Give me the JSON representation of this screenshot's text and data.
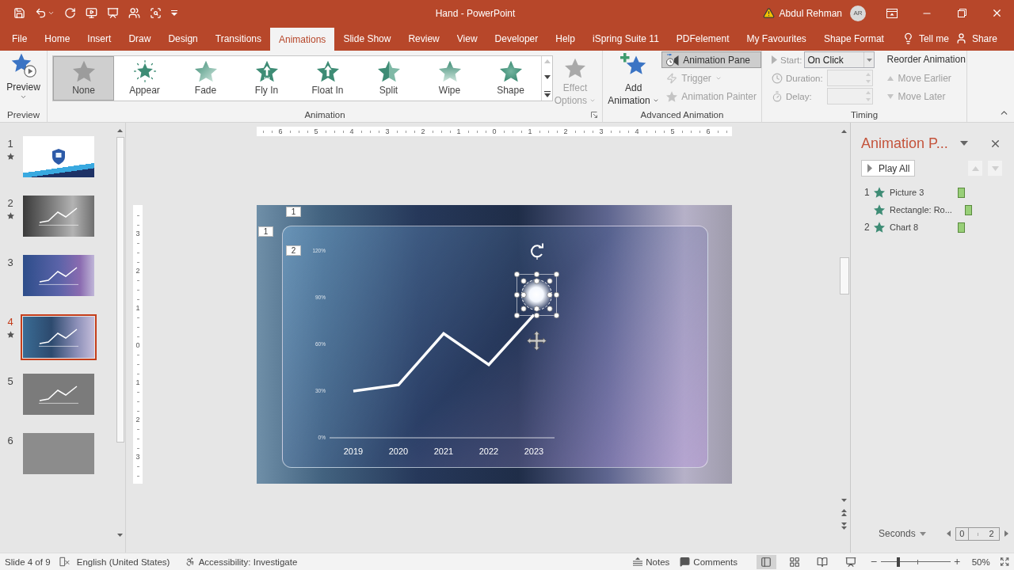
{
  "title_bar": {
    "title": "Hand - PowerPoint",
    "user_name": "Abdul Rehman",
    "user_initials": "AR"
  },
  "tabs": [
    {
      "label": "File",
      "selected": false
    },
    {
      "label": "Home",
      "selected": false
    },
    {
      "label": "Insert",
      "selected": false
    },
    {
      "label": "Draw",
      "selected": false
    },
    {
      "label": "Design",
      "selected": false
    },
    {
      "label": "Transitions",
      "selected": false
    },
    {
      "label": "Animations",
      "selected": true
    },
    {
      "label": "Slide Show",
      "selected": false
    },
    {
      "label": "Review",
      "selected": false
    },
    {
      "label": "View",
      "selected": false
    },
    {
      "label": "Developer",
      "selected": false
    },
    {
      "label": "Help",
      "selected": false
    },
    {
      "label": "iSpring Suite 11",
      "selected": false
    },
    {
      "label": "PDFelement",
      "selected": false
    },
    {
      "label": "My Favourites",
      "selected": false
    },
    {
      "label": "Shape Format",
      "selected": false
    }
  ],
  "tell_me": "Tell me",
  "share": "Share",
  "ribbon": {
    "preview": {
      "button": "Preview",
      "group_label": "Preview"
    },
    "animation": {
      "effects": [
        {
          "label": "None",
          "kind": "none",
          "selected": true
        },
        {
          "label": "Appear",
          "kind": "appear",
          "selected": false
        },
        {
          "label": "Fade",
          "kind": "fade",
          "selected": false
        },
        {
          "label": "Fly In",
          "kind": "fly_in",
          "selected": false
        },
        {
          "label": "Float In",
          "kind": "float_in",
          "selected": false
        },
        {
          "label": "Split",
          "kind": "split",
          "selected": false
        },
        {
          "label": "Wipe",
          "kind": "wipe",
          "selected": false
        },
        {
          "label": "Shape",
          "kind": "shape",
          "selected": false
        }
      ],
      "effect_options": {
        "label": "Effect Options",
        "disabled": true
      },
      "group_label": "Animation"
    },
    "advanced": {
      "add_animation": "Add Animation",
      "animation_pane": {
        "label": "Animation Pane",
        "pressed": true
      },
      "trigger": {
        "label": "Trigger",
        "disabled": true
      },
      "animation_painter": {
        "label": "Animation Painter",
        "disabled": true
      },
      "group_label": "Advanced Animation"
    },
    "timing": {
      "start": {
        "label": "Start:",
        "value": "On Click",
        "disabled": true
      },
      "duration": {
        "label": "Duration:",
        "disabled": true
      },
      "delay": {
        "label": "Delay:",
        "disabled": true
      },
      "reorder_title": "Reorder Animation",
      "move_earlier": {
        "label": "Move Earlier",
        "disabled": true
      },
      "move_later": {
        "label": "Move Later",
        "disabled": true
      },
      "group_label": "Timing"
    }
  },
  "slides_panel": {
    "slides": [
      {
        "number": "1",
        "animated": true,
        "kind": "title",
        "selected": false
      },
      {
        "number": "2",
        "animated": true,
        "kind": "photo_gray",
        "selected": false
      },
      {
        "number": "3",
        "animated": false,
        "kind": "photo_purple",
        "selected": false
      },
      {
        "number": "4",
        "animated": true,
        "kind": "photo_blue",
        "selected": true
      },
      {
        "number": "5",
        "animated": false,
        "kind": "chart",
        "selected": false
      },
      {
        "number": "6",
        "animated": false,
        "kind": "plain",
        "selected": false
      }
    ]
  },
  "rulers": {
    "horizontal": [
      "6",
      "5",
      "4",
      "3",
      "2",
      "1",
      "0",
      "1",
      "2",
      "3",
      "4",
      "5",
      "6"
    ],
    "vertical": [
      "3",
      "2",
      "1",
      "0",
      "1",
      "2",
      "3"
    ]
  },
  "slide": {
    "animation_tags": [
      "1",
      "1",
      "2"
    ],
    "chart_data": {
      "type": "line",
      "categories": [
        "2019",
        "2020",
        "2021",
        "2022",
        "2023"
      ],
      "series": [
        {
          "color": "#ffffff",
          "values": [
            30,
            34,
            67,
            47,
            79
          ]
        }
      ],
      "ylim": [
        0,
        120
      ],
      "yticks": [
        {
          "value": 0,
          "label": "0%"
        },
        {
          "value": 30,
          "label": "30%"
        },
        {
          "value": 60,
          "label": "60%"
        },
        {
          "value": 90,
          "label": "90%"
        },
        {
          "value": 120,
          "label": "120%"
        }
      ]
    }
  },
  "animation_pane": {
    "title": "Animation P...",
    "play_all": "Play All",
    "move_up": {
      "disabled": true
    },
    "move_down": {
      "disabled": true
    },
    "items": [
      {
        "order": "1",
        "name": "Picture 3",
        "kind": "on_click"
      },
      {
        "name": "Rectangle: Ro...",
        "kind": "after_previous"
      },
      {
        "order": "2",
        "name": "Chart 8",
        "kind": "on_click"
      }
    ],
    "seconds": "Seconds",
    "timeline": {
      "start": "0",
      "end": "2"
    }
  },
  "status_bar": {
    "slide_info": "Slide 4 of 9",
    "language": "English (United States)",
    "accessibility": "Accessibility: Investigate",
    "notes": "Notes",
    "comments": "Comments",
    "views": [
      {
        "kind": "normal",
        "selected": true
      },
      {
        "kind": "sorter",
        "selected": false
      },
      {
        "kind": "reading",
        "selected": false
      },
      {
        "kind": "slideshow",
        "selected": false
      }
    ],
    "zoom": {
      "level": 0.25,
      "value": "50%"
    }
  }
}
